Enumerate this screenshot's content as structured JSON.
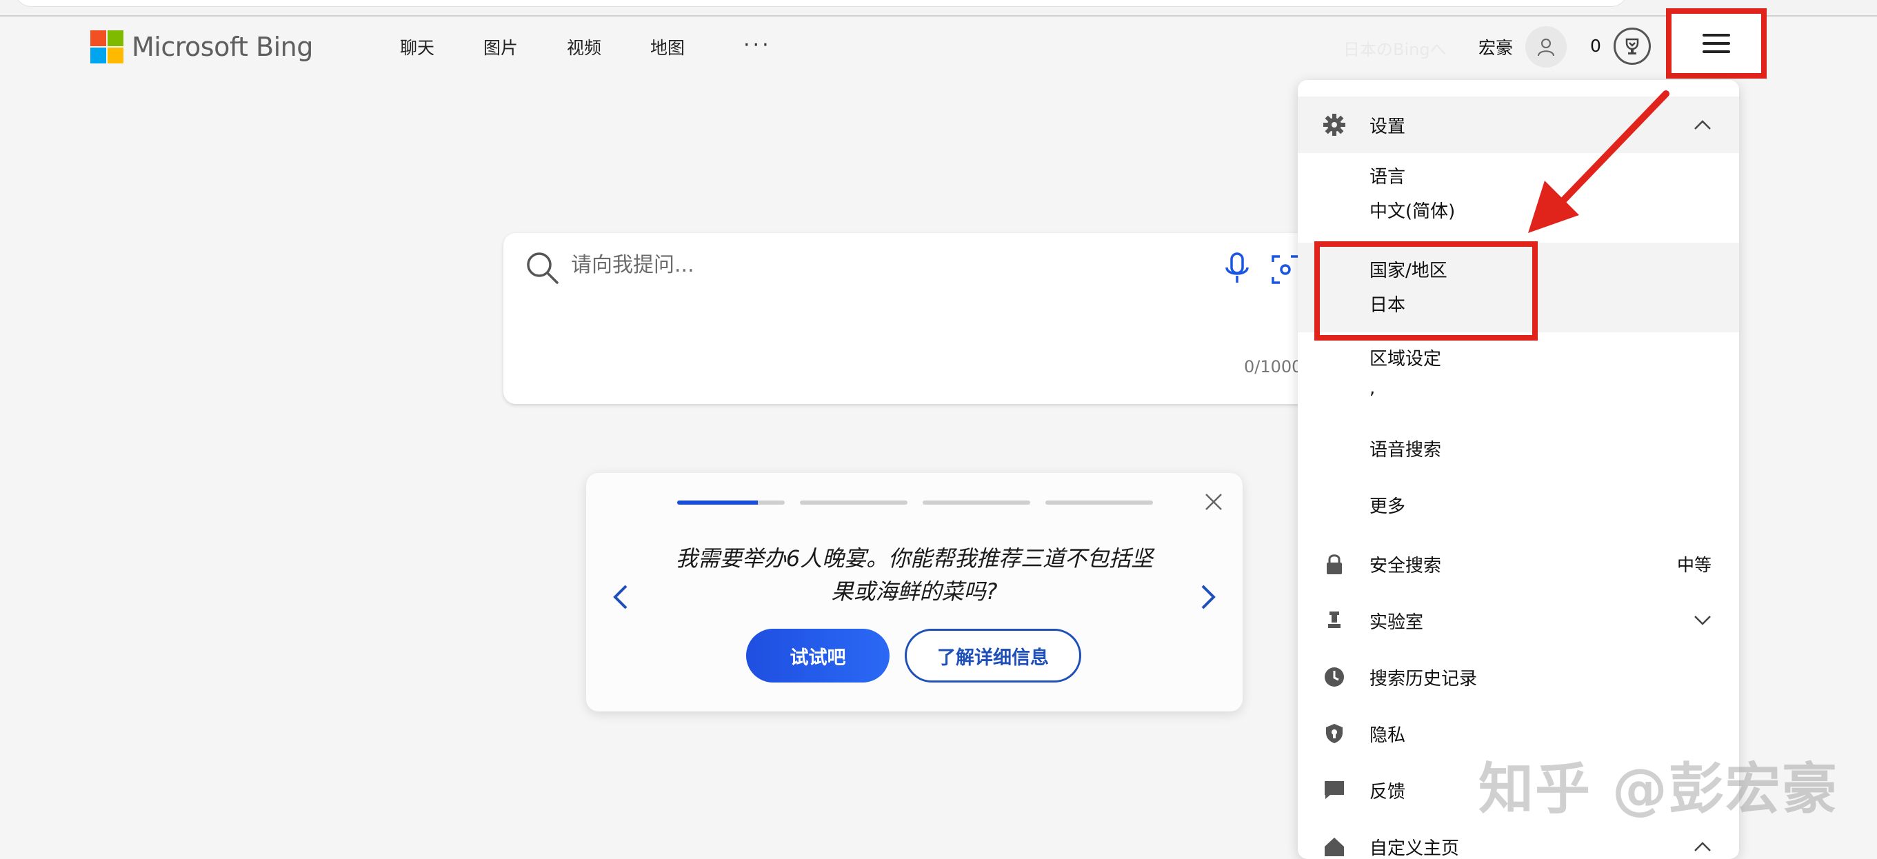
{
  "header": {
    "logo_text": "Microsoft Bing",
    "nav": [
      "聊天",
      "图片",
      "视频",
      "地图"
    ],
    "more": "···",
    "region_link": "日本のBingへ",
    "username": "宏豪",
    "points": "0"
  },
  "search": {
    "placeholder": "请向我提问...",
    "char_count": "0/1000"
  },
  "card": {
    "progress": [
      0.75,
      0,
      0,
      0
    ],
    "prompt": "我需要举办6人晚宴。你能帮我推荐三道不包括坚果或海鲜的菜吗?",
    "try_label": "试试吧",
    "learn_label": "了解详细信息"
  },
  "panel": {
    "settings_label": "设置",
    "language_label": "语言",
    "language_value": "中文(简体)",
    "country_label": "国家/地区",
    "country_value": "日本",
    "locale_label": "区域设定",
    "locale_value": ",",
    "voice_label": "语音搜索",
    "more_label": "更多",
    "safe_search_label": "安全搜索",
    "safe_search_value": "中等",
    "labs_label": "实验室",
    "history_label": "搜索历史记录",
    "privacy_label": "隐私",
    "feedback_label": "反馈",
    "customize_label": "自定义主页"
  },
  "watermark": "知乎 @彭宏豪",
  "colors": {
    "accent": "#1f4fe0",
    "annotation": "#e0241b"
  }
}
